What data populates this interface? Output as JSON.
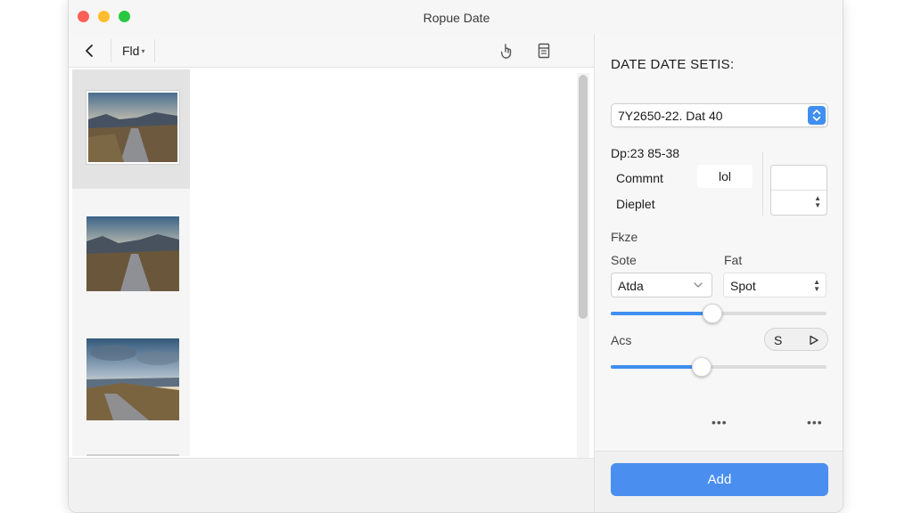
{
  "window": {
    "title": "Ropue Date"
  },
  "toolbar": {
    "folder_label": "Fld"
  },
  "inspector": {
    "title": "DATE DATE SETIS:",
    "date_value": "7Y2650-22.  Dat 40",
    "dp_label": "Dp:23 85-38",
    "comment_label": "Commnt",
    "comment_value": "lol",
    "display_label": "Dieplet",
    "size_label": "Fkze",
    "scale_label": "Sote",
    "format_label": "Fat",
    "scale_select": "Atda",
    "format_select": "Spot",
    "slider1_value": 0.47,
    "args_label": "Acs",
    "seg_label": "S",
    "slider2_value": 0.42,
    "add_button": "Add"
  },
  "colors": {
    "accent": "#4a8ff0",
    "close": "#fe5f57",
    "minimize": "#febc2e",
    "zoom": "#28c840"
  }
}
